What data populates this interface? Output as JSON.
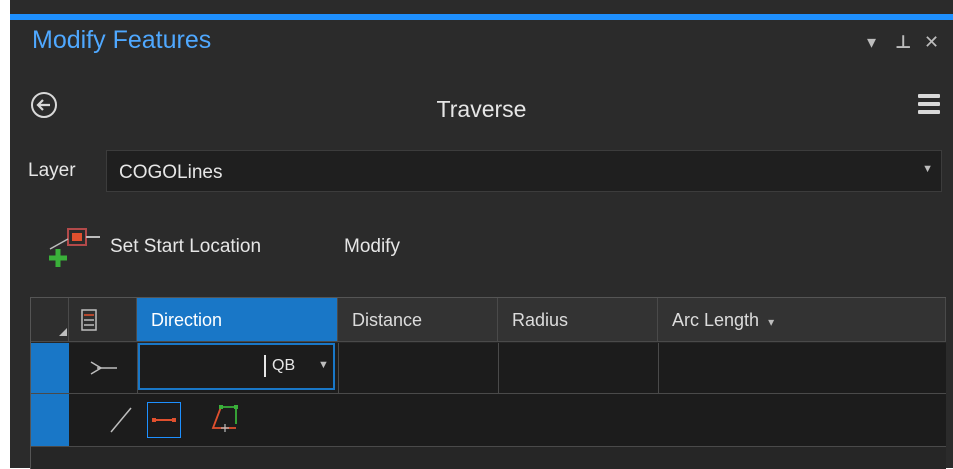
{
  "window": {
    "title": "Modify Features",
    "controls": {
      "dropdown": "▾",
      "pin": "⊥",
      "close": "✕"
    }
  },
  "header": {
    "title": "Traverse",
    "back_icon": "back-arrow-icon",
    "menu_icon": "hamburger-menu-icon"
  },
  "layer": {
    "label": "Layer",
    "value": "COGOLines"
  },
  "toolbar": {
    "set_start_label": "Set Start Location",
    "modify_label": "Modify"
  },
  "grid": {
    "columns": [
      "Direction",
      "Distance",
      "Radius",
      "Arc Length"
    ],
    "arc_length_menu": "▾",
    "direction_unit": "QB",
    "direction_value": ""
  },
  "colors": {
    "accent": "#1977c7",
    "title": "#4fa8ff",
    "background": "#2b2b2b"
  }
}
